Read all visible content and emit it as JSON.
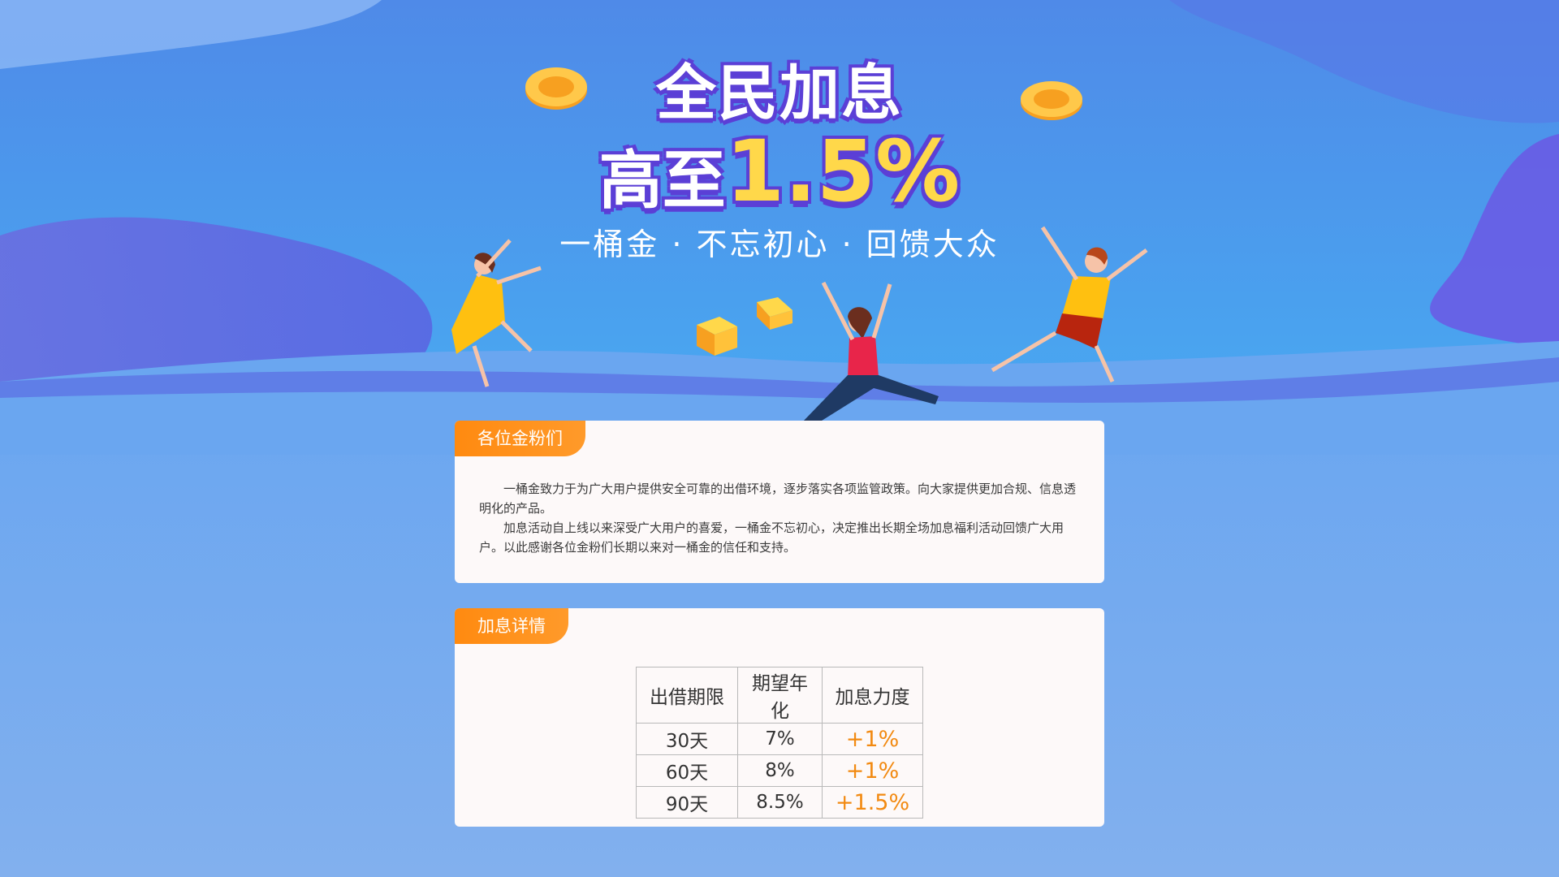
{
  "hero": {
    "line1": "全民加息",
    "line2_prefix": "高至",
    "line2_rate": "1.5%",
    "slogan": "一桶金 · 不忘初心 · 回馈大众"
  },
  "intro": {
    "tag": "各位金粉们",
    "paragraph1": "一桶金致力于为广大用户提供安全可靠的出借环境，逐步落实各项监管政策。向大家提供更加合规、信息透明化的产品。",
    "paragraph2": "加息活动自上线以来深受广大用户的喜爱，一桶金不忘初心，决定推出长期全场加息福利活动回馈广大用户。以此感谢各位金粉们长期以来对一桶金的信任和支持。"
  },
  "detail": {
    "tag": "加息详情",
    "headers": [
      "出借期限",
      "期望年化",
      "加息力度"
    ],
    "rows": [
      [
        "30天",
        "7%",
        "+1%"
      ],
      [
        "60天",
        "8%",
        "+1%"
      ],
      [
        "90天",
        "8.5%",
        "+1.5%"
      ]
    ]
  },
  "colors": {
    "accent_orange": "#ff8a10",
    "title_purple": "#5b3fd6",
    "rate_yellow": "#ffd84a"
  },
  "icons": [
    "coin-icon",
    "gold-bar-icon",
    "jumping-person-illustration"
  ]
}
